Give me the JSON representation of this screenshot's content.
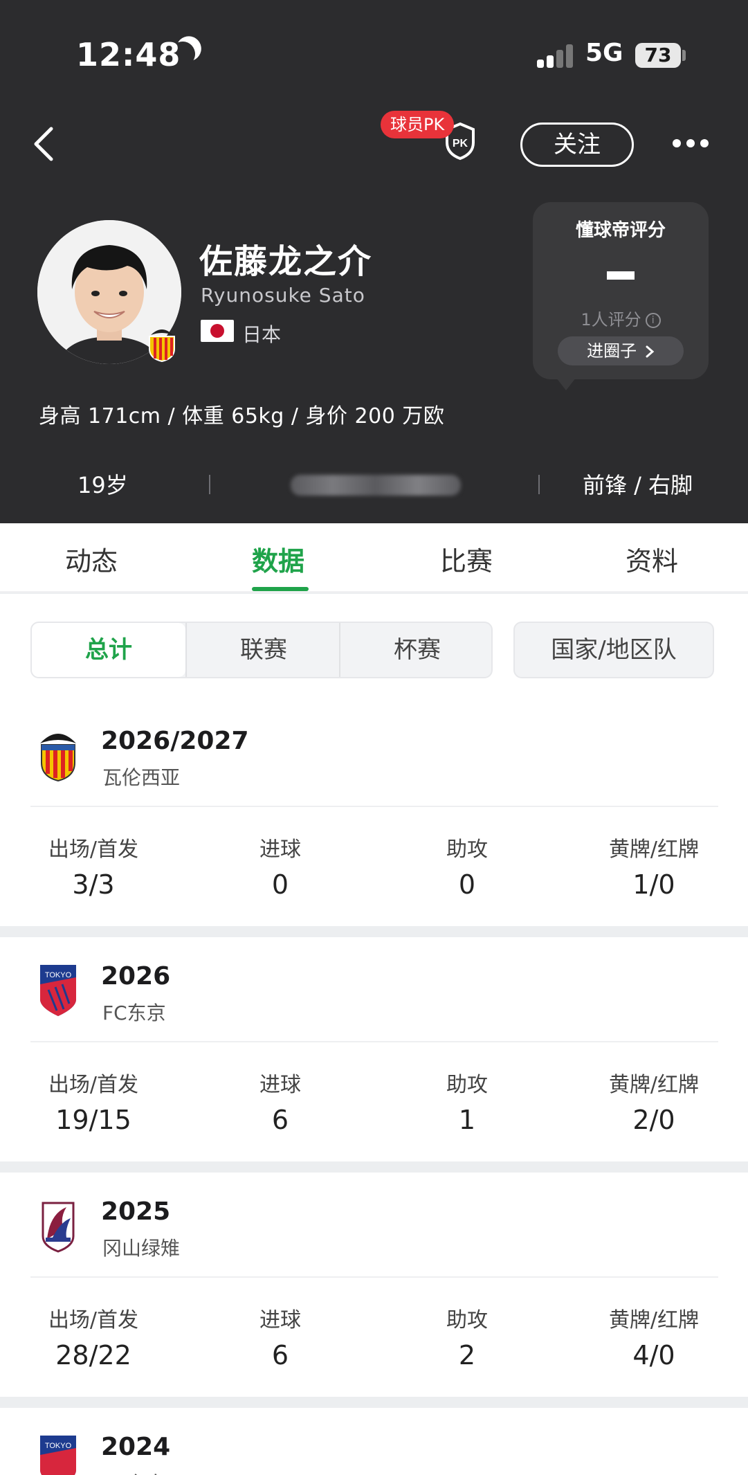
{
  "status_bar": {
    "time": "12:48",
    "network": "5G",
    "battery": "73"
  },
  "header": {
    "pk_label": "球员PK",
    "pk_icon_text": "PK",
    "follow_label": "关注",
    "more_icon": "more-dots-icon",
    "back_icon": "chevron-left-icon"
  },
  "player": {
    "name": "佐藤龙之介",
    "name_en": "Ryunosuke Sato",
    "nationality": "日本",
    "body_stats": "身高 171cm / 体重 65kg / 身价 200 万欧",
    "age": "19岁",
    "position": "前锋 / 右脚"
  },
  "rating": {
    "title": "懂球帝评分",
    "value": "-",
    "count": "1人评分",
    "circle_button": "进圈子",
    "info_icon_glyph": "i"
  },
  "tabs": [
    "动态",
    "数据",
    "比赛",
    "资料"
  ],
  "active_tab": "数据",
  "filters": [
    "总计",
    "联赛",
    "杯赛"
  ],
  "active_filter": "总计",
  "filter_national": "国家/地区队",
  "stat_labels": {
    "apps": "出场/首发",
    "goals": "进球",
    "assists": "助攻",
    "cards": "黄牌/红牌"
  },
  "seasons": [
    {
      "year": "2026/2027",
      "club": "瓦伦西亚",
      "badge": "valencia-badge-icon",
      "apps": "3/3",
      "goals": "0",
      "assists": "0",
      "cards": "1/0"
    },
    {
      "year": "2026",
      "club": "FC东京",
      "badge": "fc-tokyo-badge-icon",
      "apps": "19/15",
      "goals": "6",
      "assists": "1",
      "cards": "2/0"
    },
    {
      "year": "2025",
      "club": "冈山绿雉",
      "badge": "fagiano-okayama-badge-icon",
      "apps": "28/22",
      "goals": "6",
      "assists": "2",
      "cards": "4/0"
    },
    {
      "year": "2024",
      "club": "FC东京",
      "badge": "fc-tokyo-badge-icon"
    }
  ],
  "colors": {
    "header_bg": "#2c2c2e",
    "accent_green": "#1fa34a",
    "pk_red": "#e8333a"
  }
}
